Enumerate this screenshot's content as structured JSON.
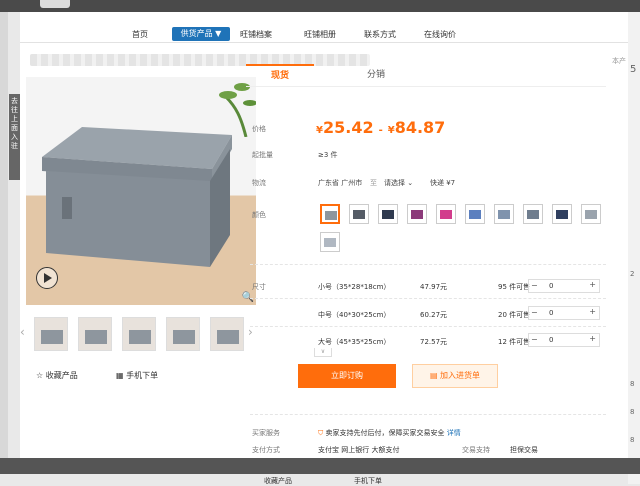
{
  "nav": {
    "items": [
      "首页",
      "供货产品 ▼",
      "旺铺档案",
      "旺铺相册",
      "联系方式",
      "在线询价"
    ]
  },
  "side_tab": "去往\n上面\n入驻",
  "right_digits": [
    "5",
    "2",
    "8",
    "8",
    "8"
  ],
  "shop_label": "本产",
  "gallery": {
    "favorite": "☆ 收藏产品",
    "mobile": "手机下单",
    "prev": "‹",
    "next": "›"
  },
  "tabs": {
    "spot": "现货",
    "distribution": "分销"
  },
  "price": {
    "label": "价格",
    "low": "25.42",
    "high": "84.87",
    "currency": "¥",
    "dash": "-"
  },
  "moq": {
    "label": "起批量",
    "value": "≥3 件"
  },
  "shipping": {
    "label": "物流",
    "from": "广东省 广州市",
    "to_label": "至",
    "to": "请选择",
    "express": "快递 ¥7"
  },
  "colors": {
    "label": "颜色",
    "swatches": [
      "#8e969e",
      "#555c66",
      "#2f3a4f",
      "#8c3a7a",
      "#d23c8c",
      "#5b7fbf",
      "#7f93ad",
      "#6f7d8e",
      "#2f3f5f",
      "#9aa3ad",
      "#b0b8c2"
    ],
    "selected_index": 0
  },
  "sizes": {
    "label": "尺寸",
    "rows": [
      {
        "name": "小号（35*28*18cm）",
        "price": "47.97元",
        "stock": "95 件可售",
        "qty": "0"
      },
      {
        "name": "中号（40*30*25cm）",
        "price": "60.27元",
        "stock": "20 件可售",
        "qty": "0"
      },
      {
        "name": "大号（45*35*25cm）",
        "price": "72.57元",
        "stock": "12 件可售",
        "qty": "0"
      }
    ],
    "minus": "−",
    "plus": "+"
  },
  "more": "∨",
  "actions": {
    "buy": "立即订购",
    "cart": "加入进货单"
  },
  "service": {
    "label": "买家服务",
    "text": "卖家支持先付后付，保障买家交易安全",
    "link": "详情"
  },
  "payment": {
    "label": "支付方式",
    "methods": "支付宝   网上银行   大额支付",
    "trade_label": "交易支持",
    "trade_value": "担保交易"
  },
  "footer": {
    "fav": "收藏产品",
    "mobile": "手机下单"
  }
}
